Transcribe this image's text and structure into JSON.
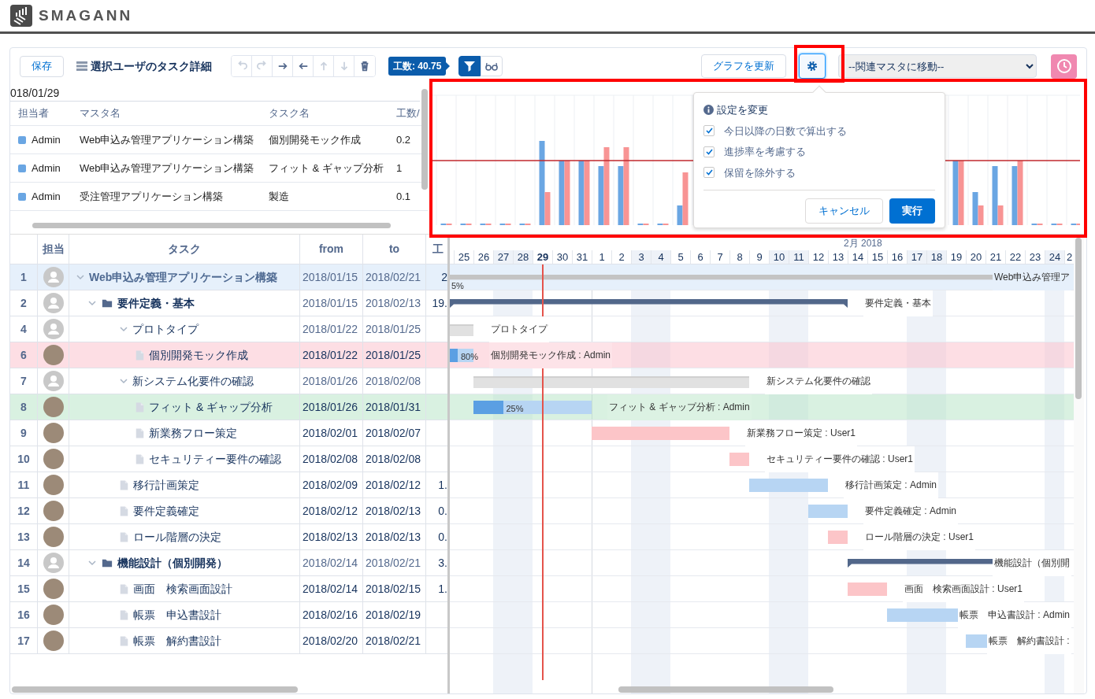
{
  "app": {
    "name": "SMAGANN"
  },
  "toolbar": {
    "save": "保存",
    "title": "選択ユーザのタスク詳細",
    "tools": [
      {
        "kind": "undo",
        "disabled": true
      },
      {
        "kind": "redo",
        "disabled": true
      },
      {
        "kind": "indent",
        "disabled": false
      },
      {
        "kind": "outdent",
        "disabled": false
      },
      {
        "kind": "up",
        "disabled": true
      },
      {
        "kind": "down",
        "disabled": true
      },
      {
        "kind": "delete",
        "disabled": false
      }
    ],
    "effort_badge": "工数: 40.75",
    "view_toggles": [
      {
        "kind": "filter",
        "selected": true
      },
      {
        "kind": "glasses",
        "selected": false
      }
    ],
    "refresh": "グラフを更新",
    "settings": {
      "selected": true
    },
    "master_select": {
      "value": "--関連マスタに移動--"
    }
  },
  "summary": {
    "date": "018/01/29",
    "columns": [
      "担当者",
      "マスタ名",
      "タスク名",
      "工数/"
    ],
    "rows": [
      {
        "user": "Admin",
        "color": "#6aa6e3",
        "master": "Web申込み管理アプリケーション構築",
        "task": "個別開発モック作成",
        "effort": "0.2"
      },
      {
        "user": "Admin",
        "color": "#6aa6e3",
        "master": "Web申込み管理アプリケーション構築",
        "task": "フィット & ギャップ分析",
        "effort": "1"
      },
      {
        "user": "Admin",
        "color": "#6aa6e3",
        "master": "受注管理アプリケーション構築",
        "task": "製造",
        "effort": "0.1"
      }
    ]
  },
  "chart_popover": {
    "title": "設定を変更",
    "options": [
      {
        "label": "今日以降の日数で算出する",
        "checked": true
      },
      {
        "label": "進捗率を考慮する",
        "checked": true
      },
      {
        "label": "保留を除外する",
        "checked": true
      }
    ],
    "cancel": "キャンセル",
    "apply": "実行"
  },
  "gantt": {
    "columns": [
      "担当",
      "タスク",
      "from",
      "to",
      "工"
    ],
    "month": "2月 2018",
    "days": [
      {
        "label": "25",
        "weekend": false,
        "today": false
      },
      {
        "label": "26",
        "weekend": false,
        "today": false
      },
      {
        "label": "27",
        "weekend": true,
        "today": false
      },
      {
        "label": "28",
        "weekend": true,
        "today": false
      },
      {
        "label": "29",
        "weekend": false,
        "today": true
      },
      {
        "label": "30",
        "weekend": false,
        "today": false
      },
      {
        "label": "31",
        "weekend": false,
        "today": false
      },
      {
        "label": "1",
        "weekend": false,
        "today": false
      },
      {
        "label": "2",
        "weekend": false,
        "today": false
      },
      {
        "label": "3",
        "weekend": true,
        "today": false
      },
      {
        "label": "4",
        "weekend": true,
        "today": false
      },
      {
        "label": "5",
        "weekend": false,
        "today": false
      },
      {
        "label": "6",
        "weekend": false,
        "today": false
      },
      {
        "label": "7",
        "weekend": false,
        "today": false
      },
      {
        "label": "8",
        "weekend": false,
        "today": false
      },
      {
        "label": "9",
        "weekend": false,
        "today": false
      },
      {
        "label": "10",
        "weekend": true,
        "today": false
      },
      {
        "label": "11",
        "weekend": true,
        "today": false
      },
      {
        "label": "12",
        "weekend": false,
        "today": false
      },
      {
        "label": "13",
        "weekend": false,
        "today": false
      },
      {
        "label": "14",
        "weekend": false,
        "today": false
      },
      {
        "label": "15",
        "weekend": false,
        "today": false
      },
      {
        "label": "16",
        "weekend": false,
        "today": false
      },
      {
        "label": "17",
        "weekend": true,
        "today": false
      },
      {
        "label": "18",
        "weekend": true,
        "today": false
      },
      {
        "label": "19",
        "weekend": false,
        "today": false
      },
      {
        "label": "20",
        "weekend": false,
        "today": false
      },
      {
        "label": "21",
        "weekend": false,
        "today": false
      },
      {
        "label": "22",
        "weekend": false,
        "today": false
      },
      {
        "label": "23",
        "weekend": false,
        "today": false
      },
      {
        "label": "24",
        "weekend": true,
        "today": false
      },
      {
        "label": "2",
        "weekend": false,
        "today": false
      }
    ],
    "rows": [
      {
        "no": "1",
        "photo": false,
        "task": "Web申込み管理アプリケーション構築",
        "kind": "project",
        "expanded": true,
        "from": "2018/01/15",
        "to": "2018/02/21",
        "effort": "2",
        "selected": true,
        "late": false,
        "on_track": false,
        "bar_label": "Web申込み管理ア",
        "progress_label": "5%",
        "children": [
          {
            "no": "2",
            "photo": false,
            "task": "要件定義・基本",
            "kind": "folder",
            "expanded": true,
            "from": "2018/01/15",
            "to": "2018/02/13",
            "effort": "19.",
            "selected": false,
            "late": false,
            "on_track": false,
            "bar_label": "要件定義・基本",
            "children": [
              {
                "no": "4",
                "photo": false,
                "task": "プロトタイプ",
                "kind": "group",
                "expanded": true,
                "from": "2018/01/22",
                "to": "2018/01/25",
                "selected": false,
                "late": false,
                "on_track": false,
                "bar_label": "プロトタイプ",
                "children": [
                  {
                    "no": "6",
                    "photo": true,
                    "task": "個別開発モック作成",
                    "kind": "task",
                    "from": "2018/01/22",
                    "to": "2018/01/25",
                    "selected": false,
                    "late": true,
                    "on_track": false,
                    "color": "#b7d5f3",
                    "level": 0.8,
                    "progress_label": "80%",
                    "bar_label": "個別開発モック作成 : Admin"
                  }
                ]
              },
              {
                "no": "7",
                "photo": false,
                "task": "新システム化要件の確認",
                "kind": "group",
                "expanded": true,
                "from": "2018/01/26",
                "to": "2018/02/08",
                "selected": false,
                "late": false,
                "on_track": false,
                "bar_label": "新システム化要件の確認",
                "children": [
                  {
                    "no": "8",
                    "photo": true,
                    "task": "フィット & ギャップ分析",
                    "kind": "task",
                    "from": "2018/01/26",
                    "to": "2018/01/31",
                    "selected": false,
                    "late": false,
                    "on_track": true,
                    "color": "#b7d5f3",
                    "level": 0.25,
                    "progress_label": "25%",
                    "bar_label": "フィット & ギャップ分析 : Admin"
                  },
                  {
                    "no": "9",
                    "photo": true,
                    "task": "新業務フロー策定",
                    "kind": "task",
                    "from": "2018/02/01",
                    "to": "2018/02/07",
                    "selected": false,
                    "late": false,
                    "on_track": false,
                    "color": "#fcc5c8",
                    "bar_label": "新業務フロー策定 : User1"
                  },
                  {
                    "no": "10",
                    "photo": true,
                    "task": "セキュリティー要件の確認",
                    "kind": "task",
                    "from": "2018/02/08",
                    "to": "2018/02/08",
                    "selected": false,
                    "late": false,
                    "on_track": false,
                    "color": "#fcc5c8",
                    "bar_label": "セキュリティー要件の確認 : User1"
                  }
                ]
              },
              {
                "no": "11",
                "photo": true,
                "task": "移行計画策定",
                "kind": "task",
                "from": "2018/02/09",
                "to": "2018/02/12",
                "effort": "1.",
                "selected": false,
                "late": false,
                "on_track": false,
                "color": "#b7d5f3",
                "bar_label": "移行計画策定 : Admin"
              },
              {
                "no": "12",
                "photo": true,
                "task": "要件定義確定",
                "kind": "task",
                "from": "2018/02/12",
                "to": "2018/02/13",
                "effort": "0.",
                "selected": false,
                "late": false,
                "on_track": false,
                "color": "#b7d5f3",
                "bar_label": "要件定義確定 : Admin"
              },
              {
                "no": "13",
                "photo": true,
                "task": "ロール階層の決定",
                "kind": "task",
                "from": "2018/02/13",
                "to": "2018/02/13",
                "effort": "0.",
                "selected": false,
                "late": false,
                "on_track": false,
                "color": "#fcc5c8",
                "bar_label": "ロール階層の決定 : User1"
              }
            ]
          },
          {
            "no": "14",
            "photo": false,
            "task": "機能設計（個別開発）",
            "kind": "folder",
            "expanded": true,
            "from": "2018/02/14",
            "to": "2018/02/21",
            "effort": "3.",
            "selected": false,
            "late": false,
            "on_track": false,
            "bar_label": "機能設計（個別開",
            "children": [
              {
                "no": "15",
                "photo": true,
                "task": "画面　検索画面設計",
                "kind": "task",
                "from": "2018/02/14",
                "to": "2018/02/15",
                "effort": "1.",
                "selected": false,
                "late": false,
                "on_track": false,
                "color": "#fcc5c8",
                "bar_label": "画面　検索画面設計 : User1"
              },
              {
                "no": "16",
                "photo": true,
                "task": "帳票　申込書設計",
                "kind": "task",
                "from": "2018/02/16",
                "to": "2018/02/19",
                "selected": false,
                "late": false,
                "on_track": false,
                "color": "#b7d5f3",
                "bar_label": "帳票　申込書設計 : Admin"
              },
              {
                "no": "17",
                "photo": true,
                "task": "帳票　解約書設計",
                "kind": "task",
                "from": "2018/02/20",
                "to": "2018/02/21",
                "selected": false,
                "late": false,
                "on_track": false,
                "color": "#b7d5f3",
                "bar_label": "帳票　解約書設計 :"
              }
            ]
          }
        ]
      }
    ]
  }
}
